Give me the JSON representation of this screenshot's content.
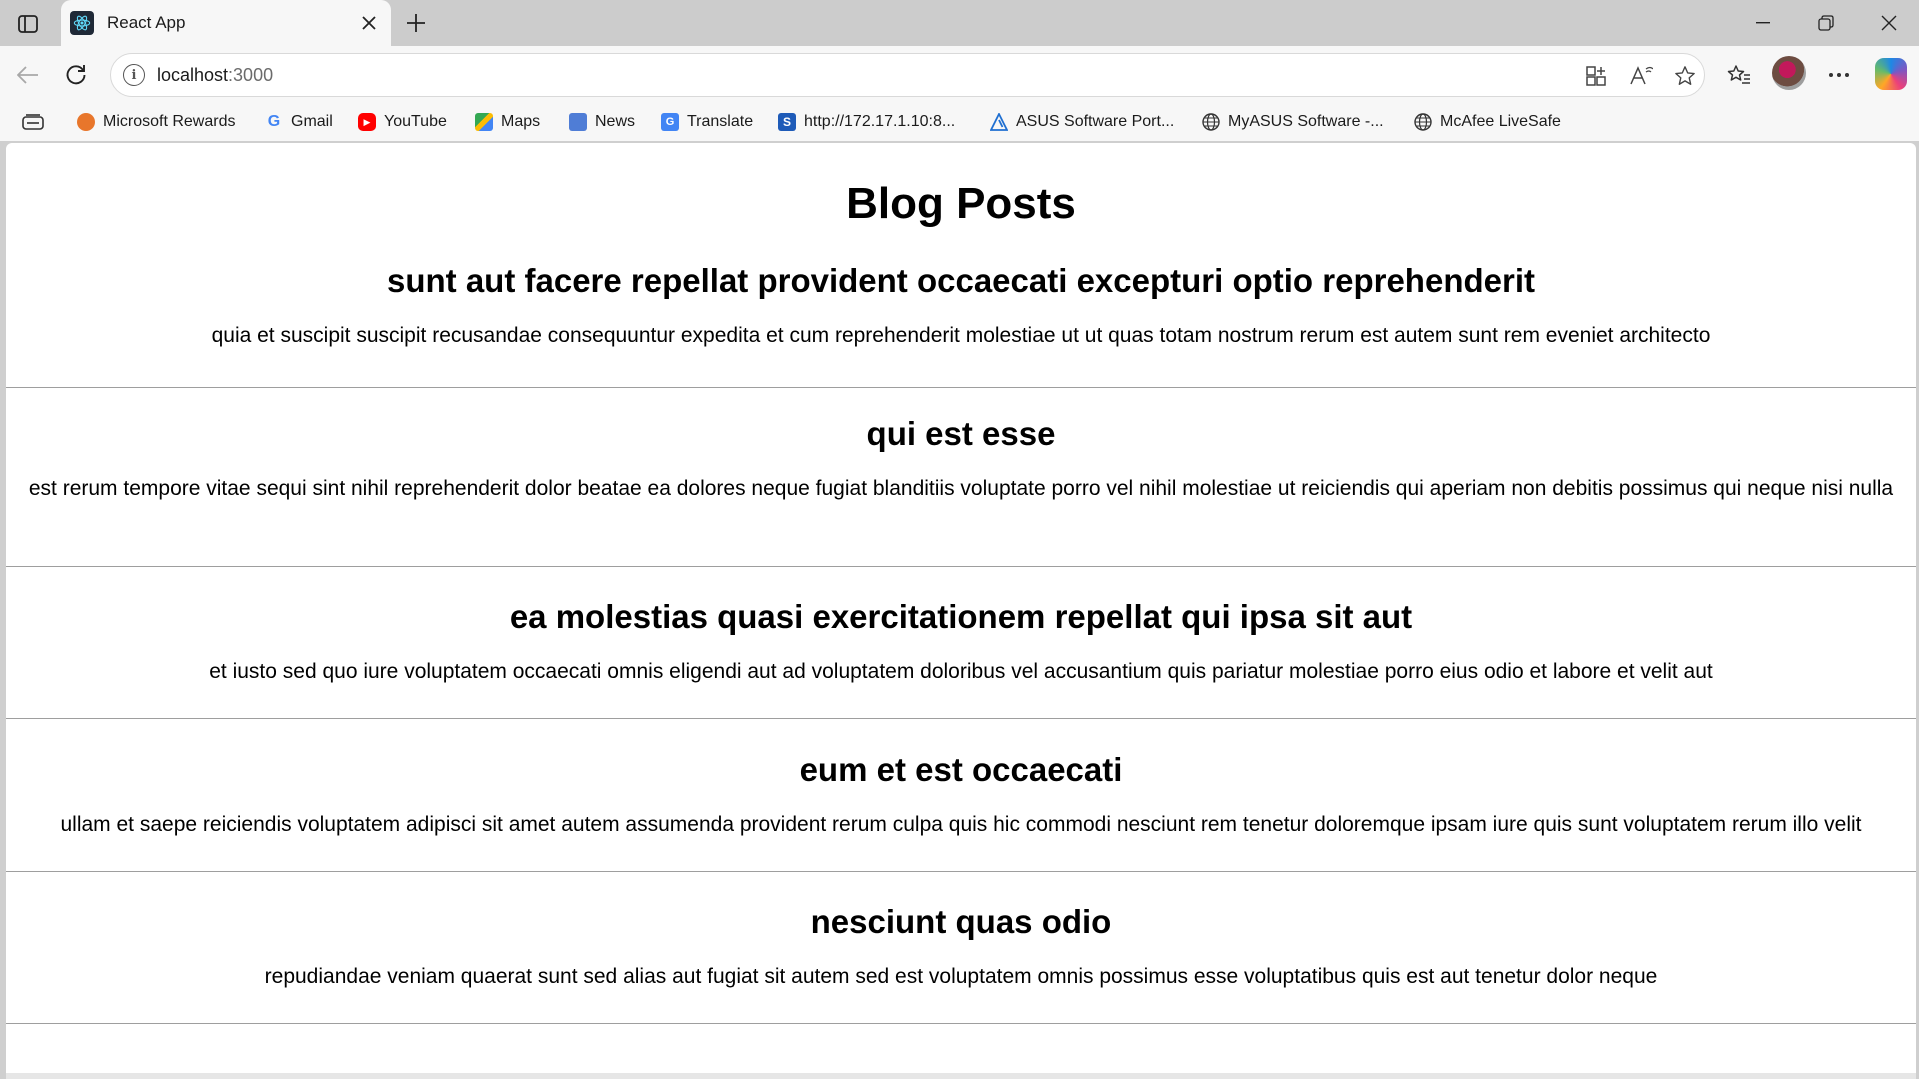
{
  "tab": {
    "title": "React App"
  },
  "address_bar": {
    "host": "localhost",
    "port": ":3000"
  },
  "bookmarks": [
    {
      "label": "Microsoft Rewards",
      "icon": "medal-icon"
    },
    {
      "label": "Gmail",
      "icon": "google-icon"
    },
    {
      "label": "YouTube",
      "icon": "youtube-icon"
    },
    {
      "label": "Maps",
      "icon": "maps-icon"
    },
    {
      "label": "News",
      "icon": "news-icon"
    },
    {
      "label": "Translate",
      "icon": "translate-icon"
    },
    {
      "label": "http://172.17.1.10:8...",
      "icon": "s-icon"
    },
    {
      "label": "ASUS Software Port...",
      "icon": "asus-icon"
    },
    {
      "label": "MyASUS Software -...",
      "icon": "globe-icon"
    },
    {
      "label": "McAfee LiveSafe",
      "icon": "globe-icon"
    }
  ],
  "page": {
    "heading": "Blog Posts",
    "posts": [
      {
        "title": "sunt aut facere repellat provident occaecati excepturi optio reprehenderit",
        "body": "quia et suscipit suscipit recusandae consequuntur expedita et cum reprehenderit molestiae ut ut quas totam nostrum rerum est autem sunt rem eveniet architecto"
      },
      {
        "title": "qui est esse",
        "body": "est rerum tempore vitae sequi sint nihil reprehenderit dolor beatae ea dolores neque fugiat blanditiis voluptate porro vel nihil molestiae ut reiciendis qui aperiam non debitis possimus qui neque nisi nulla"
      },
      {
        "title": "ea molestias quasi exercitationem repellat qui ipsa sit aut",
        "body": "et iusto sed quo iure voluptatem occaecati omnis eligendi aut ad voluptatem doloribus vel accusantium quis pariatur molestiae porro eius odio et labore et velit aut"
      },
      {
        "title": "eum et est occaecati",
        "body": "ullam et saepe reiciendis voluptatem adipisci sit amet autem assumenda provident rerum culpa quis hic commodi nesciunt rem tenetur doloremque ipsam iure quis sunt voluptatem rerum illo velit"
      },
      {
        "title": "nesciunt quas odio",
        "body": "repudiandae veniam quaerat sunt sed alias aut fugiat sit autem sed est voluptatem omnis possimus esse voluptatibus quis est aut tenetur dolor neque"
      }
    ]
  }
}
